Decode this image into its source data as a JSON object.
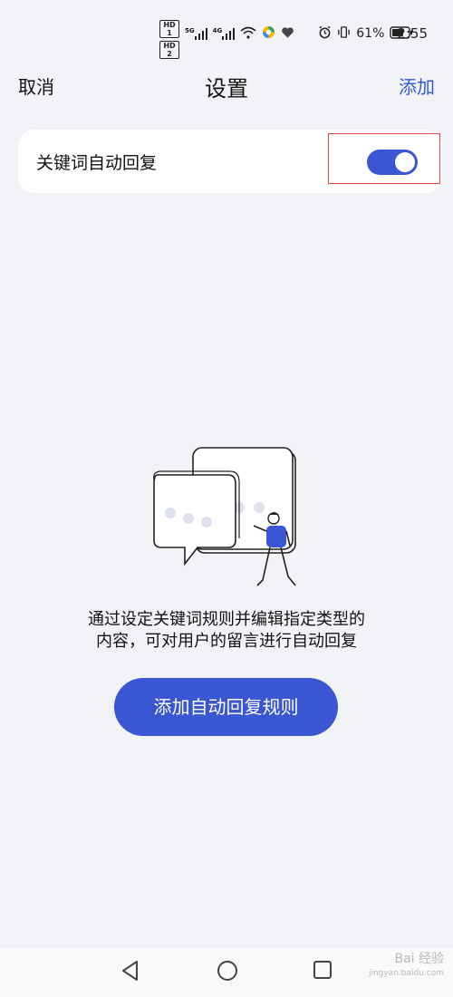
{
  "status_bar": {
    "hd1": "HD 1",
    "hd2": "HD 2",
    "signal1": "5G",
    "signal2": "4G",
    "battery": "61%",
    "time": "2:55",
    "icons": [
      "signal-icon",
      "signal-icon",
      "wifi-icon",
      "app-icon",
      "heart-icon",
      "alarm-icon",
      "vibrate-icon",
      "battery-icon"
    ]
  },
  "nav": {
    "cancel": "取消",
    "title": "设置",
    "add": "添加"
  },
  "setting": {
    "label": "关键词自动回复",
    "toggle_on": true
  },
  "empty_state": {
    "line1": "通过设定关键词规则并编辑指定类型的",
    "line2": "内容，可对用户的留言进行自动回复",
    "button": "添加自动回复规则"
  },
  "watermark": {
    "text": "Bai 经验",
    "url": "jingyan.baidu.com"
  },
  "colors": {
    "accent": "#3a56d2",
    "link": "#2f5bd3",
    "background": "#f2f3f7",
    "highlight": "#d94a4a"
  }
}
